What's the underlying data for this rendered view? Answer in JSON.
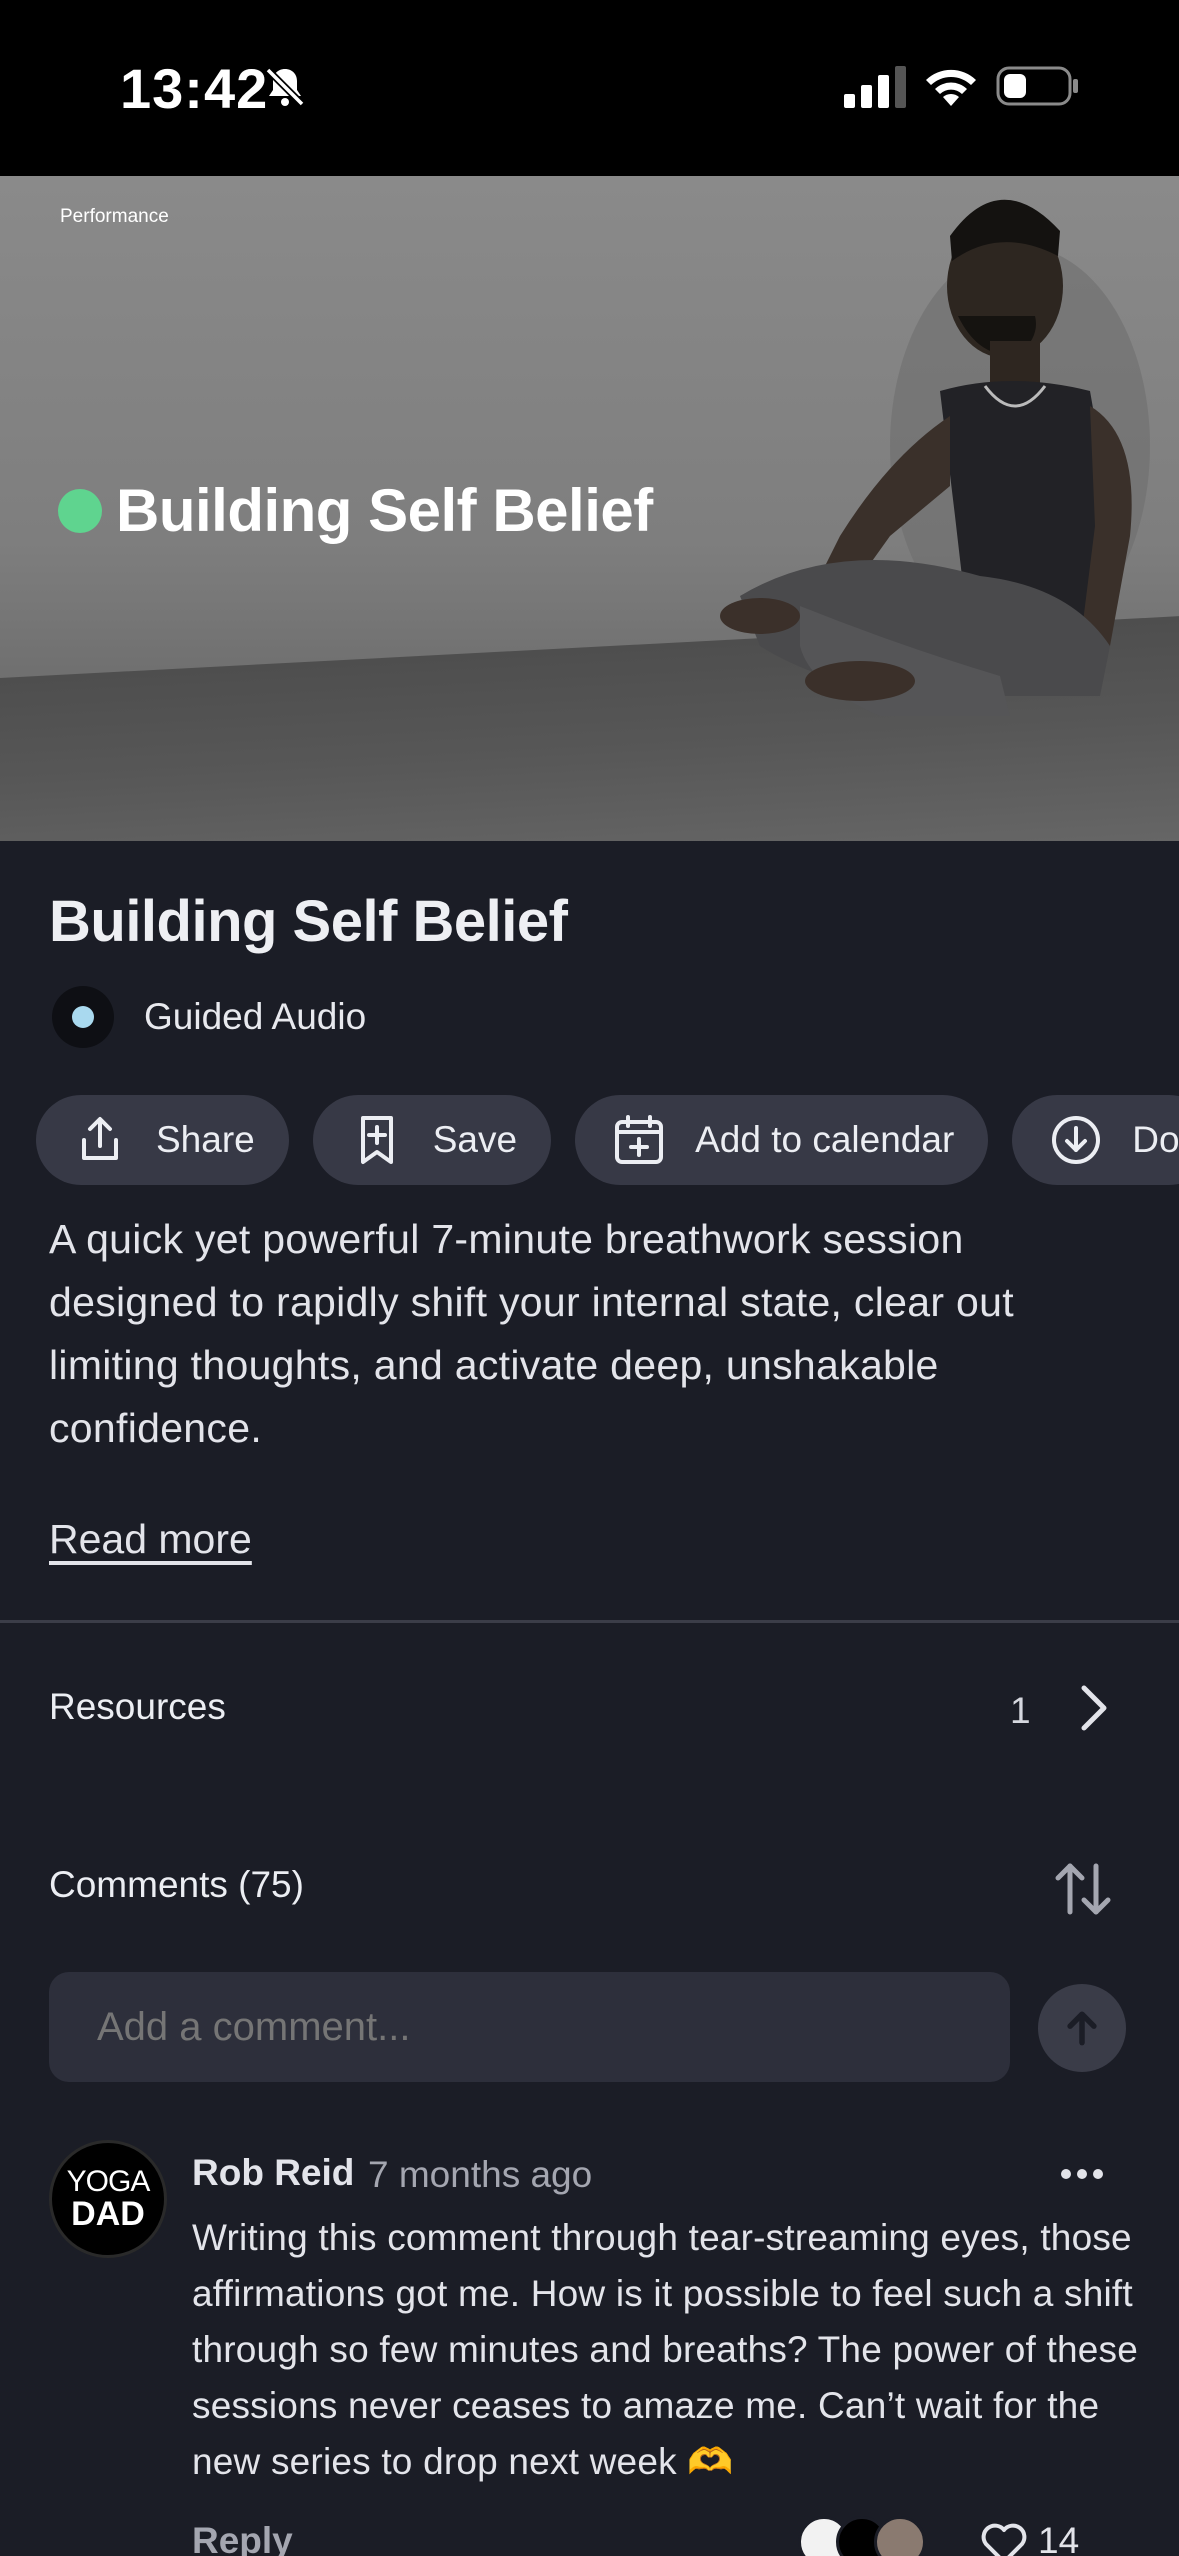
{
  "status_bar": {
    "time": "13:42",
    "icons": [
      "bell-slash-icon",
      "cellular-signal-icon",
      "wifi-icon",
      "battery-icon"
    ]
  },
  "hero": {
    "category": "Performance",
    "title": "Building Self Belief",
    "dot_color": "#5fd48f"
  },
  "content": {
    "title": "Building Self Belief",
    "type_label": "Guided Audio",
    "actions": [
      {
        "label": "Share",
        "icon": "share-icon"
      },
      {
        "label": "Save",
        "icon": "bookmark-icon"
      },
      {
        "label": "Add to calendar",
        "icon": "calendar-add-icon"
      },
      {
        "label": "Do",
        "icon": "download-icon"
      }
    ],
    "description": "A quick yet powerful 7-minute breathwork session designed to rapidly shift your internal state, clear out limiting thoughts, and activate deep, unshakable confidence.",
    "read_more": "Read more"
  },
  "resources": {
    "label": "Resources",
    "count": "1"
  },
  "comments": {
    "header": "Comments (75)",
    "input_placeholder": "Add a comment...",
    "items": [
      {
        "avatar_line1": "YOGA",
        "avatar_line2": "DAD",
        "author": "Rob Reid",
        "time": "7 months ago",
        "body": "Writing this comment through tear-streaming eyes, those affirmations got me. How is it possible to feel such a shift through so few minutes and breaths? The power of these sessions never ceases to amaze me. Can’t wait for the new series to drop next week 🫶",
        "reply_label": "Reply",
        "like_count": "14"
      }
    ]
  },
  "colors": {
    "background": "#1b1d26",
    "chip": "#373946",
    "input": "#2d2f3b",
    "accent_green": "#5fd48f"
  }
}
